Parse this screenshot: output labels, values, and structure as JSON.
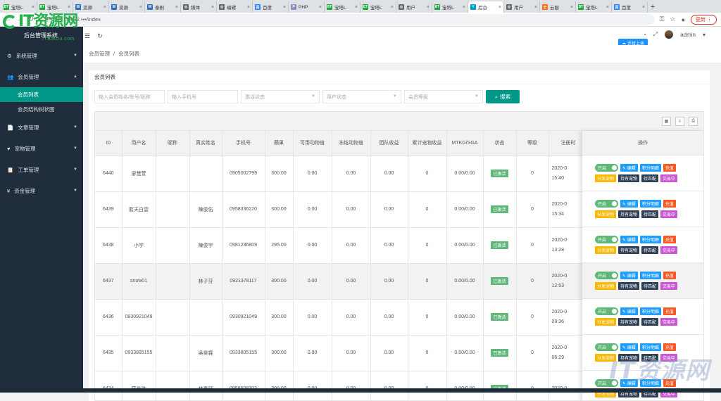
{
  "browser": {
    "tabs": [
      {
        "label": "宝塔L",
        "fav": "BT",
        "color": "#20a53a"
      },
      {
        "label": "宝塔L",
        "fav": "BT",
        "color": "#20a53a"
      },
      {
        "label": "资源",
        "fav": "W",
        "color": "#2e6fba"
      },
      {
        "label": "资源",
        "fav": "W",
        "color": "#2e6fba"
      },
      {
        "label": "泰剧",
        "fav": "W",
        "color": "#2e6fba"
      },
      {
        "label": "媒体",
        "fav": "◎",
        "color": "#666666"
      },
      {
        "label": "编辑",
        "fav": "◎",
        "color": "#666666"
      },
      {
        "label": "百度",
        "fav": "百",
        "color": "#3385ff"
      },
      {
        "label": "PHP",
        "fav": "P",
        "color": "#8892bf"
      },
      {
        "label": "宝塔L",
        "fav": "BT",
        "color": "#20a53a"
      },
      {
        "label": "宝塔L",
        "fav": "BT",
        "color": "#20a53a"
      },
      {
        "label": "用户",
        "fav": "◎",
        "color": "#666666"
      },
      {
        "label": "宝塔L",
        "fav": "BT",
        "color": "#20a53a"
      },
      {
        "label": "后台",
        "fav": "Y",
        "color": "#0099cc",
        "active": true
      },
      {
        "label": "用户",
        "fav": "◎",
        "color": "#666666"
      },
      {
        "label": "云服",
        "fav": "云",
        "color": "#ff6a00"
      },
      {
        "label": "宝塔L",
        "fav": "BT",
        "color": "#20a53a"
      },
      {
        "label": "百度",
        "fav": "百",
        "color": "#3385ff"
      }
    ],
    "url_security": "不安全",
    "url_text": "154.92.▪▪▪/index",
    "update_label": "更新"
  },
  "brand": {
    "logo_text": "IT资源网",
    "sub": "后台管理系统",
    "site": "ITBaiDu.com"
  },
  "topbar": {
    "user": "admin",
    "badge": "连接上来"
  },
  "sidebar": {
    "items": [
      {
        "label": "系统管理",
        "icon": "⚙",
        "arrow": "▼"
      },
      {
        "label": "会员管理",
        "icon": "👥",
        "arrow": "▲"
      },
      {
        "label": "文章管理",
        "icon": "📄",
        "arrow": "▼"
      },
      {
        "label": "宠物管理",
        "icon": "♥",
        "arrow": "▼"
      },
      {
        "label": "工单管理",
        "icon": "📋",
        "arrow": "▼"
      },
      {
        "label": "资金管理",
        "icon": "¥",
        "arrow": "▼"
      }
    ],
    "sub_items": [
      {
        "label": "会员列表",
        "active": true
      },
      {
        "label": "会员结构树状图",
        "active": false
      }
    ]
  },
  "breadcrumb": {
    "home": "会员管理",
    "sep": "/",
    "current": "会员列表"
  },
  "card": {
    "title": "会员列表"
  },
  "filters": {
    "name_placeholder": "输入会员姓名/账号/昵称",
    "phone_placeholder": "输入手机号",
    "activate_placeholder": "激活状态",
    "user_status_placeholder": "用户状态",
    "level_placeholder": "会员等级",
    "search_label": "搜索"
  },
  "table": {
    "headers": [
      "ID",
      "用户名",
      "昵称",
      "真实姓名",
      "手机号",
      "蘋果",
      "可用动物值",
      "冻结动物值",
      "团队收益",
      "累计宠物收益",
      "MTKG/SGA",
      "状态",
      "等级",
      "注册时"
    ],
    "ops_header": "操作",
    "rows": [
      {
        "id": "6440",
        "username": "廖慧萱",
        "nickname": "",
        "realname": "",
        "phone": "0905002799",
        "apple": "300.00",
        "avail": "0.00",
        "frozen": "0.00",
        "team": "0.00",
        "pet": "0",
        "mtkg": "0.00/0.00",
        "status": "已激活",
        "level": "0",
        "date1": "2020-0",
        "date2": "15:40"
      },
      {
        "id": "6439",
        "username": "藍天白雲",
        "nickname": "",
        "realname": "陳俊佑",
        "phone": "0958336220",
        "apple": "300.00",
        "avail": "0.00",
        "frozen": "0.00",
        "team": "0.00",
        "pet": "0",
        "mtkg": "0.00/0.00",
        "status": "已激活",
        "level": "0",
        "date1": "2020-0",
        "date2": "15:34"
      },
      {
        "id": "6438",
        "username": "小宇",
        "nickname": "",
        "realname": "陳俊宇",
        "phone": "0981236809",
        "apple": "295.00",
        "avail": "0.00",
        "frozen": "0.00",
        "team": "0.00",
        "pet": "0",
        "mtkg": "0.00/0.00",
        "status": "已激活",
        "level": "0",
        "date1": "2020-0",
        "date2": "13:28"
      },
      {
        "id": "6437",
        "username": "snow01",
        "nickname": "",
        "realname": "林子芬",
        "phone": "0921378117",
        "apple": "300.00",
        "avail": "0.00",
        "frozen": "0.00",
        "team": "0.00",
        "pet": "0",
        "mtkg": "0.00/0.00",
        "status": "已激活",
        "level": "0",
        "date1": "2020-0",
        "date2": "12:53"
      },
      {
        "id": "6436",
        "username": "0930921049",
        "nickname": "",
        "realname": "",
        "phone": "0930921049",
        "apple": "300.00",
        "avail": "0.00",
        "frozen": "0.00",
        "team": "0.00",
        "pet": "0",
        "mtkg": "0.00/0.00",
        "status": "已激活",
        "level": "0",
        "date1": "2020-0",
        "date2": "09:36"
      },
      {
        "id": "6435",
        "username": "0933885155",
        "nickname": "",
        "realname": "吳昊霖",
        "phone": "0933805155",
        "apple": "300.00",
        "avail": "0.00",
        "frozen": "0.00",
        "team": "0.00",
        "pet": "0",
        "mtkg": "0.00/0.00",
        "status": "已激活",
        "level": "0",
        "date1": "2020-0",
        "date2": "06:29"
      },
      {
        "id": "6434",
        "username": "蘇世雅",
        "nickname": "",
        "realname": "林彥廷",
        "phone": "0958608103",
        "apple": "300.00",
        "avail": "0.00",
        "frozen": "0.00",
        "team": "0.00",
        "pet": "0",
        "mtkg": "0.00/0.00",
        "status": "已激活",
        "level": "0",
        "date1": "2020-0",
        "date2": ""
      }
    ],
    "highlight_row": 3
  },
  "ops": {
    "switch_label": "开启",
    "row1": [
      {
        "label": "✎ 编辑",
        "color": "#1e9fff"
      },
      {
        "label": "积分明细",
        "color": "#1e9fff"
      },
      {
        "label": "充值",
        "color": "#ff5722"
      }
    ],
    "row2": [
      {
        "label": "分发宠物",
        "color": "#ffb800"
      },
      {
        "label": "持有宠物",
        "color": "#2f4056"
      },
      {
        "label": "待匹配",
        "color": "#2f4056"
      },
      {
        "label": "交易中",
        "color": "#c957d3"
      }
    ]
  },
  "watermark": "IT资源网",
  "colors": {
    "accent": "#009688",
    "sidebar": "#1f2d3d",
    "status_green": "#5fb878"
  }
}
